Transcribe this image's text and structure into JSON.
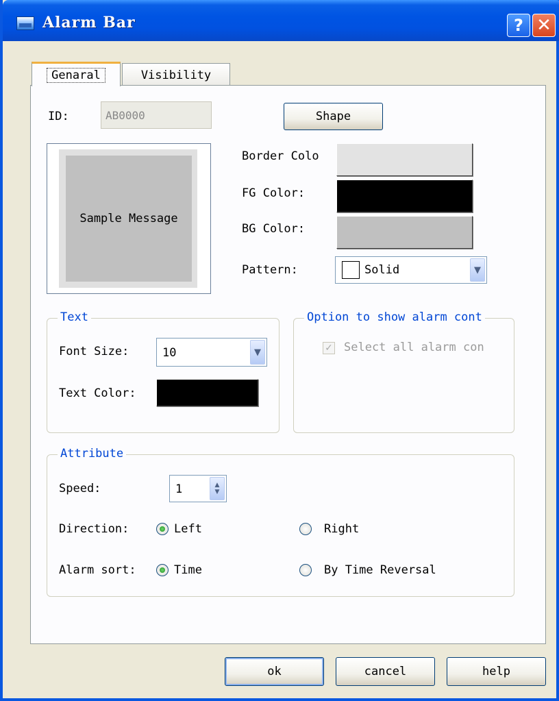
{
  "window": {
    "title": "Alarm Bar",
    "help_glyph": "?",
    "close_glyph": "✕"
  },
  "tabs": [
    {
      "label": "Genaral",
      "selected": true
    },
    {
      "label": "Visibility",
      "selected": false
    }
  ],
  "general": {
    "id_label": "ID:",
    "id_value": "AB0000",
    "shape_button": "Shape",
    "preview_text": "Sample Message",
    "border_color_label": "Border Colo",
    "fg_color_label": "FG Color:",
    "bg_color_label": "BG Color:",
    "pattern_label": "Pattern:",
    "pattern_value": "Solid",
    "colors": {
      "border": "#e3e3e3",
      "fg": "#000000",
      "bg": "#c0c0c0"
    }
  },
  "text_group": {
    "title": "Text",
    "font_size_label": "Font Size:",
    "font_size_value": "10",
    "text_color_label": "Text Color:",
    "text_color": "#000000"
  },
  "option_group": {
    "title": "Option to show alarm cont",
    "select_all_label": "Select all alarm con",
    "select_all_checked": true,
    "select_all_disabled": true
  },
  "attribute_group": {
    "title": "Attribute",
    "speed_label": "Speed:",
    "speed_value": "1",
    "direction_label": "Direction:",
    "direction_options": [
      "Left",
      "Right"
    ],
    "direction_selected": "Left",
    "sort_label": "Alarm sort:",
    "sort_options": [
      "Time",
      "By Time Reversal"
    ],
    "sort_selected": "Time"
  },
  "buttons": {
    "ok": "ok",
    "cancel": "cancel",
    "help": "help"
  }
}
